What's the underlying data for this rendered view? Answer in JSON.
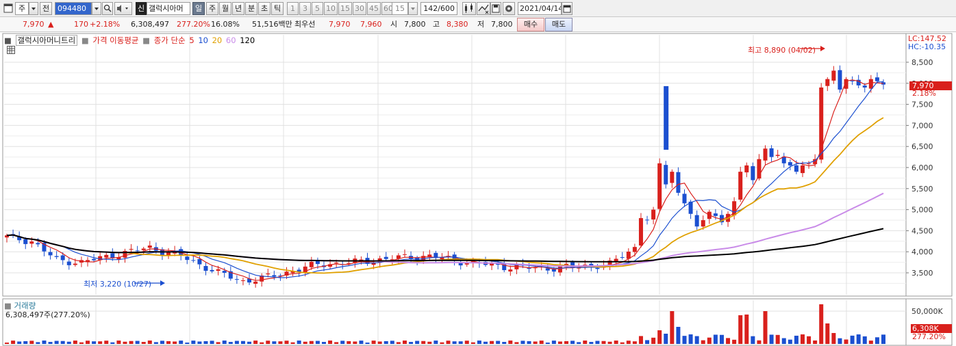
{
  "toolbar": {
    "market_type": "주",
    "prev_label": "전",
    "code": "094480",
    "stock_badge": "신",
    "stock_name": "갤럭시아머",
    "periods": [
      "일",
      "주",
      "월",
      "년",
      "분",
      "초",
      "틱"
    ],
    "active_period": "일",
    "intervals": [
      "1",
      "3",
      "5",
      "10",
      "15",
      "30",
      "45",
      "60"
    ],
    "interval_select": "15",
    "count_display": "142/600",
    "date": "2021/04/14"
  },
  "quote": {
    "price": "7,970",
    "change_arrow": "▲",
    "change": "170",
    "change_pct": "+2.18%",
    "volume": "6,308,497",
    "volume_ratio": "277.20%",
    "turnover": "16.08%",
    "amount": "51,516백만",
    "best_label": "최우선",
    "best_ask": "7,970",
    "best_bid": "7,960",
    "open_label": "시",
    "open": "7,800",
    "high_label": "고",
    "high": "8,380",
    "low_label": "저",
    "low": "7,800",
    "buy_label": "매수",
    "sell_label": "매도"
  },
  "price_panel": {
    "legend_name": "갤럭시아머니트리",
    "legend_ma_label": "가격 이동평균",
    "legend_ma_spec": "종가 단순",
    "ma_periods": [
      "5",
      "10",
      "20",
      "60",
      "120"
    ],
    "ma_colors": [
      "#d9201c",
      "#1b4fd0",
      "#e0a000",
      "#c98be8",
      "#000000"
    ],
    "lc_label": "LC:147.52",
    "hc_label": "HC:-10.35",
    "max_annotation": "최고 8,890 (04/02)",
    "min_annotation": "최저 3,220 (10/27)",
    "last_price_tag": "7,970",
    "last_pct_tag": "2.18%",
    "y_ticks": [
      "8,500",
      "8,000",
      "7,500",
      "7,000",
      "6,500",
      "6,000",
      "5,500",
      "5,000",
      "4,500",
      "4,000",
      "3,500"
    ]
  },
  "volume_panel": {
    "title": "거래량",
    "value_line": "6,308,497주(277.20%)",
    "y_tick": "50,000K",
    "last_tag": "6,308K",
    "last_pct_tag": "277.20%"
  },
  "colors": {
    "up": "#d9201c",
    "down": "#1b4fd0",
    "grid": "#e0e0e0"
  }
}
